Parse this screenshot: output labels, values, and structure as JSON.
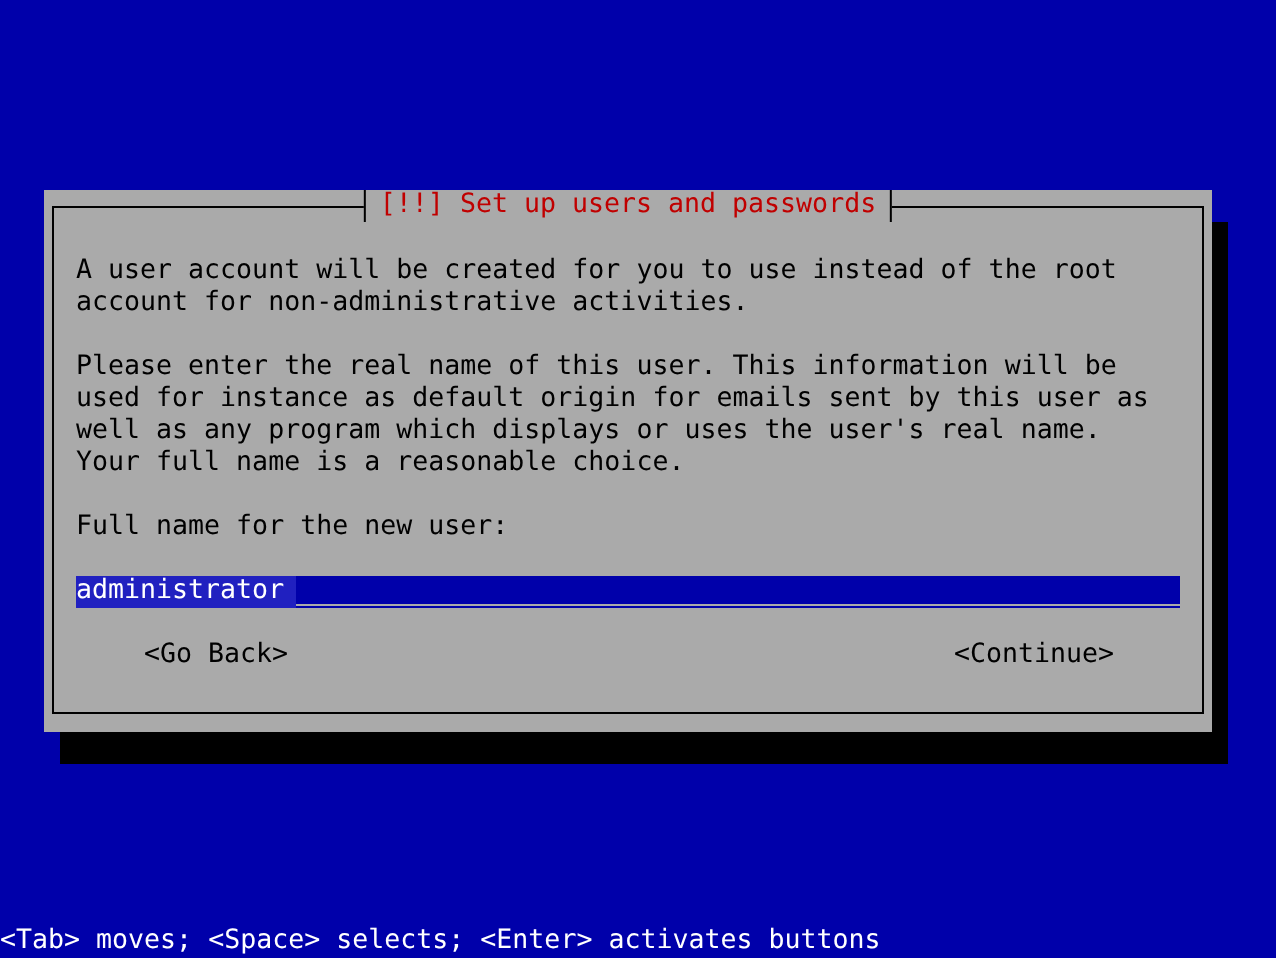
{
  "dialog": {
    "title": "[!!] Set up users and passwords",
    "paragraphs": [
      "A user account will be created for you to use instead of the root account for non-administrative activities.",
      "Please enter the real name of this user. This information will be used for instance as default origin for emails sent by this user as well as any program which displays or uses the user's real name. Your full name is a reasonable choice."
    ],
    "field": {
      "label": "Full name for the new user:",
      "value": "administrator"
    },
    "buttons": [
      "<Go Back>",
      "<Continue>"
    ]
  },
  "status_bar": "<Tab> moves; <Space> selects; <Enter> activates buttons"
}
